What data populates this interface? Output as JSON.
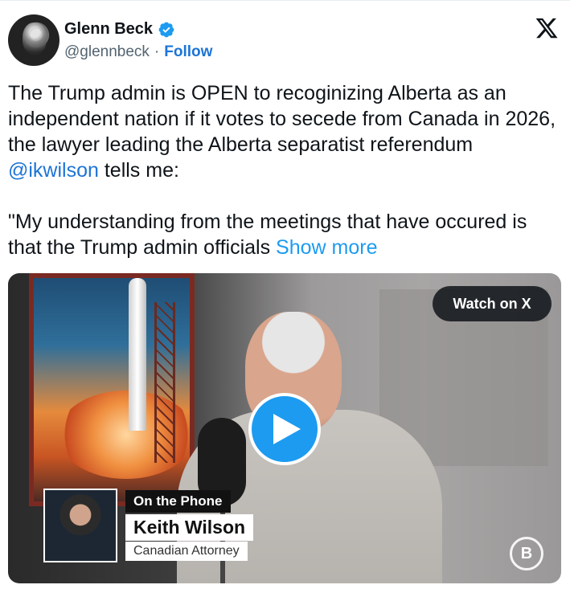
{
  "author": {
    "name": "Glenn Beck",
    "handle": "@glennbeck",
    "separator": "·",
    "follow_label": "Follow",
    "verified_icon": "verified-badge-icon"
  },
  "platform_icon": "x-logo-icon",
  "tweet": {
    "para1_text": "The Trump admin is OPEN to recoginizing Alberta as an independent nation if it votes to secede from Canada in 2026, the lawyer leading the Alberta separatist referendum ",
    "mention": "@ikwilson",
    "para1_tail": " tells me:",
    "para2_text": "\"My understanding from the meetings that have occured is that the Trump admin officials ",
    "show_more": "Show more"
  },
  "media": {
    "watch_label": "Watch on X",
    "play_icon": "play-icon",
    "lower_third": {
      "kicker": "On the Phone",
      "name": "Keith Wilson",
      "title": "Canadian Attorney"
    },
    "brand_badge": "B"
  },
  "colors": {
    "link": "#1d74d6",
    "show_more": "#1d9bf0",
    "play_button": "#1d9bf0"
  }
}
